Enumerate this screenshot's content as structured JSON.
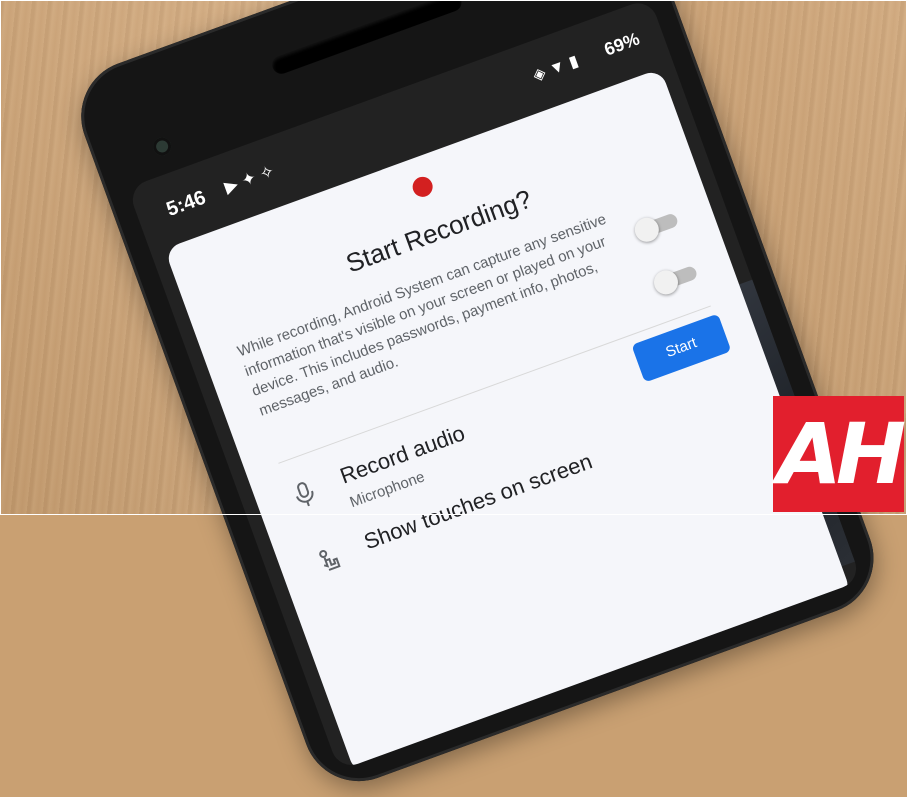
{
  "status_bar": {
    "time": "5:46",
    "notification_icons": [
      "youtube-icon",
      "twitter-icon",
      "sparkle-icon"
    ],
    "system_icons": [
      "vibrate-icon",
      "wifi-icon",
      "battery-icon"
    ],
    "battery": "69%"
  },
  "dialog": {
    "title": "Start Recording?",
    "body": "While recording, Android System can capture any sensitive information that's visible on your screen or played on your device. This includes passwords, payment info, photos, messages, and audio.",
    "options": [
      {
        "title": "Record audio",
        "subtitle": "Microphone",
        "icon": "microphone-icon",
        "enabled": false
      },
      {
        "title": "Show touches on screen",
        "subtitle": "",
        "icon": "touch-icon",
        "enabled": false
      }
    ],
    "start_button": "Start"
  },
  "logo": {
    "text": "AH",
    "color": "#e21f2d"
  },
  "colors": {
    "accent": "#1a73e8",
    "record_dot": "#d32020"
  }
}
